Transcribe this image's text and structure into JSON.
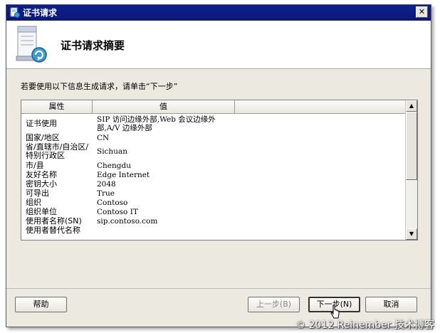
{
  "window": {
    "title": "证书请求",
    "close_glyph": "✕"
  },
  "header": {
    "title": "证书请求摘要",
    "icon": "certificate-request-icon"
  },
  "instruction": "若要使用以下信息生成请求，请单击“下一步”",
  "grid": {
    "columns": [
      "属性",
      "值",
      ""
    ],
    "rows": [
      {
        "attr": "证书使用",
        "value": "SIP 访问边缘外部,Web 会议边缘外部,A/V 边缘外部"
      },
      {
        "attr": "国家/地区",
        "value": "CN"
      },
      {
        "attr": "省/直辖市/自治区/特别行政区",
        "value": "Sichuan"
      },
      {
        "attr": "市/县",
        "value": "Chengdu"
      },
      {
        "attr": "友好名称",
        "value": "Edge Internet"
      },
      {
        "attr": "密钥大小",
        "value": "2048"
      },
      {
        "attr": "可导出",
        "value": "True"
      },
      {
        "attr": "组织",
        "value": "Contoso"
      },
      {
        "attr": "组织单位",
        "value": "Contoso IT"
      },
      {
        "attr": "使用者名称(SN)",
        "value": "sip.contoso.com"
      },
      {
        "attr": "使用者替代名称",
        "value": ""
      }
    ]
  },
  "buttons": {
    "help": "帮助",
    "back": "上一步(B)",
    "next": "下一步(N)",
    "cancel": "取消"
  },
  "watermark": "© 2012 Reinember 技术博客"
}
